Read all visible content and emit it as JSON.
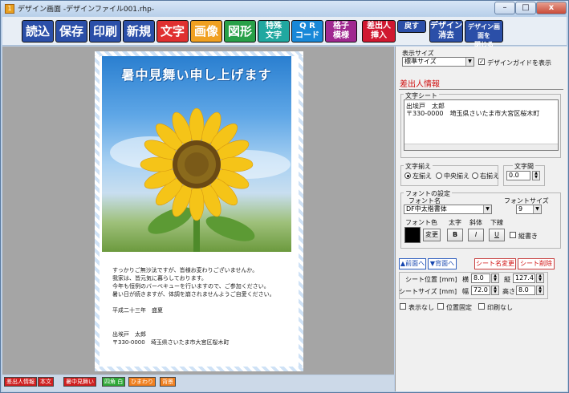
{
  "window": {
    "title": "デザイン画面 -デザインファイル001.rhp-",
    "app_icon": "1",
    "controls": {
      "minimize": "–",
      "maximize": "□",
      "close": "x"
    }
  },
  "toolbar": {
    "read": "読込",
    "save": "保存",
    "print": "印刷",
    "new": "新規",
    "text": "文字",
    "image": "画像",
    "shape": "図形",
    "special_text_1": "特殊",
    "special_text_2": "文字",
    "qr_1": "Q R",
    "qr_2": "コード",
    "grid_1": "格子",
    "grid_2": "模様",
    "merge_1": "差出人",
    "merge_2": "挿入",
    "back": "戻す",
    "design_clear_1": "デザイン",
    "design_clear_2": "消去",
    "close_design_1": "デザイン画面を",
    "close_design_2": "閉じる",
    "colors": {
      "read": "#2b4fa8",
      "save": "#2b4fa8",
      "print": "#2b4fa8",
      "new": "#2b4fa8",
      "text": "#e03030",
      "image": "#f0a020",
      "shape": "#28a048",
      "special": "#20a8a0",
      "qr": "#1888d8",
      "grid": "#a02890",
      "merge": "#d01830",
      "back": "#2b4fa8",
      "clear": "#2b4fa8",
      "close": "#2b4fa8"
    }
  },
  "paper": {
    "headline": "暑中見舞い申し上げます",
    "letter_lines": [
      "すっかりご無沙汰ですが、皆様お変わりございませんか。",
      "我家は、皆元気に暮らしております。",
      "今年も恒例のバーベキューを行いますので、ご参加ください。",
      "暑い日が続きますが、体調を崩されませんようご自愛ください。",
      "",
      "平成二十三年　盛夏",
      "",
      "",
      "出埃戸　太郎",
      "〒330-0000　埼玉県さいたま市大宮区桜木町"
    ]
  },
  "bottom_tabs": [
    {
      "label": "差出人情報",
      "color": "#d02020"
    },
    {
      "label": "本文",
      "color": "#d02020"
    },
    {
      "label": "暑中見舞い",
      "color": "#d02020"
    },
    {
      "label": "四角 白",
      "color": "#30a838"
    },
    {
      "label": "ひまわり",
      "color": "#f08020"
    },
    {
      "label": "背景",
      "color": "#f08020"
    }
  ],
  "side": {
    "display_size_label": "表示サイズ",
    "display_size_value": "標準サイズ",
    "design_guide_label": "デザインガイドを表示",
    "design_guide_checked": true,
    "section_title": "差出人情報",
    "text_sheet_label": "文字シート",
    "text_sheet_lines": [
      "出埃戸　太郎",
      "〒330-0000　埼玉県さいたま市大宮区桜木町"
    ],
    "align_label": "文字揃え",
    "align_left": "左揃え",
    "align_center": "中央揃え",
    "align_right": "右揃え",
    "spacing_label": "文字間",
    "spacing_value": "0.0",
    "font_setting_label": "フォントの設定",
    "font_name_label": "フォント名",
    "font_name_value": "DF中太楷書体",
    "font_size_label": "フォントサイズ",
    "font_size_value": "9",
    "font_color_label": "フォント色",
    "bold_label": "太字",
    "italic_label": "斜体",
    "underline_label": "下線",
    "change_button": "変更",
    "bold_btn": "B",
    "italic_btn": "I",
    "underline_btn": "U",
    "vertical_label": "縦書き",
    "front_btn": "▲前面へ",
    "back_btn": "▼背面へ",
    "sheet_rename_btn": "シート名変更",
    "sheet_delete_btn": "シート削除",
    "pos_label": "シート位置 [mm]",
    "size_label": "シートサイズ [mm]",
    "horiz_label": "横",
    "vert_label": "縦",
    "width_label": "幅",
    "height_label": "高さ",
    "pos_x": "8.0",
    "pos_y": "127.4",
    "width": "72.0",
    "height": "8.0",
    "hide_label": "表示なし",
    "fix_pos_label": "位置固定",
    "no_print_label": "印刷なし"
  }
}
